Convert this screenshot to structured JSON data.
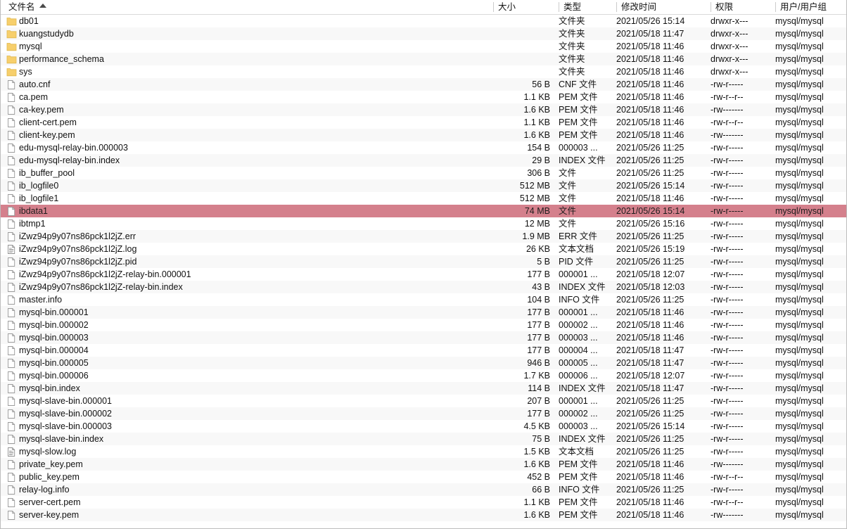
{
  "header": {
    "columns": [
      {
        "key": "name",
        "label": "文件名",
        "sorted": true,
        "sort_dir": "asc"
      },
      {
        "key": "size",
        "label": "大小",
        "sorted": false
      },
      {
        "key": "type",
        "label": "类型",
        "sorted": false
      },
      {
        "key": "mtime",
        "label": "修改时间",
        "sorted": false
      },
      {
        "key": "perm",
        "label": "权限",
        "sorted": false
      },
      {
        "key": "owner",
        "label": "用户/用户组",
        "sorted": false
      }
    ]
  },
  "colors": {
    "selection": "#d4808c",
    "row_alt": "#f8f8f8",
    "folder_icon": "#f7cf6b",
    "text": "#111111"
  },
  "rows": [
    {
      "icon": "folder-icon",
      "name": "db01",
      "size": "",
      "type": "文件夹",
      "mtime": "2021/05/26 15:14",
      "perm": "drwxr-x---",
      "owner": "mysql/mysql",
      "selected": false
    },
    {
      "icon": "folder-icon",
      "name": "kuangstudydb",
      "size": "",
      "type": "文件夹",
      "mtime": "2021/05/18 11:47",
      "perm": "drwxr-x---",
      "owner": "mysql/mysql",
      "selected": false
    },
    {
      "icon": "folder-icon",
      "name": "mysql",
      "size": "",
      "type": "文件夹",
      "mtime": "2021/05/18 11:46",
      "perm": "drwxr-x---",
      "owner": "mysql/mysql",
      "selected": false
    },
    {
      "icon": "folder-icon",
      "name": "performance_schema",
      "size": "",
      "type": "文件夹",
      "mtime": "2021/05/18 11:46",
      "perm": "drwxr-x---",
      "owner": "mysql/mysql",
      "selected": false
    },
    {
      "icon": "folder-icon",
      "name": "sys",
      "size": "",
      "type": "文件夹",
      "mtime": "2021/05/18 11:46",
      "perm": "drwxr-x---",
      "owner": "mysql/mysql",
      "selected": false
    },
    {
      "icon": "file-icon",
      "name": "auto.cnf",
      "size": "56 B",
      "type": "CNF 文件",
      "mtime": "2021/05/18 11:46",
      "perm": "-rw-r-----",
      "owner": "mysql/mysql",
      "selected": false
    },
    {
      "icon": "file-icon",
      "name": "ca.pem",
      "size": "1.1 KB",
      "type": "PEM 文件",
      "mtime": "2021/05/18 11:46",
      "perm": "-rw-r--r--",
      "owner": "mysql/mysql",
      "selected": false
    },
    {
      "icon": "file-icon",
      "name": "ca-key.pem",
      "size": "1.6 KB",
      "type": "PEM 文件",
      "mtime": "2021/05/18 11:46",
      "perm": "-rw-------",
      "owner": "mysql/mysql",
      "selected": false
    },
    {
      "icon": "file-icon",
      "name": "client-cert.pem",
      "size": "1.1 KB",
      "type": "PEM 文件",
      "mtime": "2021/05/18 11:46",
      "perm": "-rw-r--r--",
      "owner": "mysql/mysql",
      "selected": false
    },
    {
      "icon": "file-icon",
      "name": "client-key.pem",
      "size": "1.6 KB",
      "type": "PEM 文件",
      "mtime": "2021/05/18 11:46",
      "perm": "-rw-------",
      "owner": "mysql/mysql",
      "selected": false
    },
    {
      "icon": "file-icon",
      "name": "edu-mysql-relay-bin.000003",
      "size": "154 B",
      "type": "000003 ...",
      "mtime": "2021/05/26 11:25",
      "perm": "-rw-r-----",
      "owner": "mysql/mysql",
      "selected": false
    },
    {
      "icon": "file-icon",
      "name": "edu-mysql-relay-bin.index",
      "size": "29 B",
      "type": "INDEX 文件",
      "mtime": "2021/05/26 11:25",
      "perm": "-rw-r-----",
      "owner": "mysql/mysql",
      "selected": false
    },
    {
      "icon": "file-icon",
      "name": "ib_buffer_pool",
      "size": "306 B",
      "type": "文件",
      "mtime": "2021/05/26 11:25",
      "perm": "-rw-r-----",
      "owner": "mysql/mysql",
      "selected": false
    },
    {
      "icon": "file-icon",
      "name": "ib_logfile0",
      "size": "512 MB",
      "type": "文件",
      "mtime": "2021/05/26 15:14",
      "perm": "-rw-r-----",
      "owner": "mysql/mysql",
      "selected": false
    },
    {
      "icon": "file-icon",
      "name": "ib_logfile1",
      "size": "512 MB",
      "type": "文件",
      "mtime": "2021/05/18 11:46",
      "perm": "-rw-r-----",
      "owner": "mysql/mysql",
      "selected": false
    },
    {
      "icon": "file-icon",
      "name": "ibdata1",
      "size": "74 MB",
      "type": "文件",
      "mtime": "2021/05/26 15:14",
      "perm": "-rw-r-----",
      "owner": "mysql/mysql",
      "selected": true
    },
    {
      "icon": "file-icon",
      "name": "ibtmp1",
      "size": "12 MB",
      "type": "文件",
      "mtime": "2021/05/26 15:16",
      "perm": "-rw-r-----",
      "owner": "mysql/mysql",
      "selected": false
    },
    {
      "icon": "file-icon",
      "name": "iZwz94p9y07ns86pck1l2jZ.err",
      "size": "1.9 MB",
      "type": "ERR 文件",
      "mtime": "2021/05/26 11:25",
      "perm": "-rw-r-----",
      "owner": "mysql/mysql",
      "selected": false
    },
    {
      "icon": "text-file-icon",
      "name": "iZwz94p9y07ns86pck1l2jZ.log",
      "size": "26 KB",
      "type": "文本文档",
      "mtime": "2021/05/26 15:19",
      "perm": "-rw-r-----",
      "owner": "mysql/mysql",
      "selected": false
    },
    {
      "icon": "file-icon",
      "name": "iZwz94p9y07ns86pck1l2jZ.pid",
      "size": "5 B",
      "type": "PID 文件",
      "mtime": "2021/05/26 11:25",
      "perm": "-rw-r-----",
      "owner": "mysql/mysql",
      "selected": false
    },
    {
      "icon": "file-icon",
      "name": "iZwz94p9y07ns86pck1l2jZ-relay-bin.000001",
      "size": "177 B",
      "type": "000001 ...",
      "mtime": "2021/05/18 12:07",
      "perm": "-rw-r-----",
      "owner": "mysql/mysql",
      "selected": false
    },
    {
      "icon": "file-icon",
      "name": "iZwz94p9y07ns86pck1l2jZ-relay-bin.index",
      "size": "43 B",
      "type": "INDEX 文件",
      "mtime": "2021/05/18 12:03",
      "perm": "-rw-r-----",
      "owner": "mysql/mysql",
      "selected": false
    },
    {
      "icon": "file-icon",
      "name": "master.info",
      "size": "104 B",
      "type": "INFO 文件",
      "mtime": "2021/05/26 11:25",
      "perm": "-rw-r-----",
      "owner": "mysql/mysql",
      "selected": false
    },
    {
      "icon": "file-icon",
      "name": "mysql-bin.000001",
      "size": "177 B",
      "type": "000001 ...",
      "mtime": "2021/05/18 11:46",
      "perm": "-rw-r-----",
      "owner": "mysql/mysql",
      "selected": false
    },
    {
      "icon": "file-icon",
      "name": "mysql-bin.000002",
      "size": "177 B",
      "type": "000002 ...",
      "mtime": "2021/05/18 11:46",
      "perm": "-rw-r-----",
      "owner": "mysql/mysql",
      "selected": false
    },
    {
      "icon": "file-icon",
      "name": "mysql-bin.000003",
      "size": "177 B",
      "type": "000003 ...",
      "mtime": "2021/05/18 11:46",
      "perm": "-rw-r-----",
      "owner": "mysql/mysql",
      "selected": false
    },
    {
      "icon": "file-icon",
      "name": "mysql-bin.000004",
      "size": "177 B",
      "type": "000004 ...",
      "mtime": "2021/05/18 11:47",
      "perm": "-rw-r-----",
      "owner": "mysql/mysql",
      "selected": false
    },
    {
      "icon": "file-icon",
      "name": "mysql-bin.000005",
      "size": "946 B",
      "type": "000005 ...",
      "mtime": "2021/05/18 11:47",
      "perm": "-rw-r-----",
      "owner": "mysql/mysql",
      "selected": false
    },
    {
      "icon": "file-icon",
      "name": "mysql-bin.000006",
      "size": "1.7 KB",
      "type": "000006 ...",
      "mtime": "2021/05/18 12:07",
      "perm": "-rw-r-----",
      "owner": "mysql/mysql",
      "selected": false
    },
    {
      "icon": "file-icon",
      "name": "mysql-bin.index",
      "size": "114 B",
      "type": "INDEX 文件",
      "mtime": "2021/05/18 11:47",
      "perm": "-rw-r-----",
      "owner": "mysql/mysql",
      "selected": false
    },
    {
      "icon": "file-icon",
      "name": "mysql-slave-bin.000001",
      "size": "207 B",
      "type": "000001 ...",
      "mtime": "2021/05/26 11:25",
      "perm": "-rw-r-----",
      "owner": "mysql/mysql",
      "selected": false
    },
    {
      "icon": "file-icon",
      "name": "mysql-slave-bin.000002",
      "size": "177 B",
      "type": "000002 ...",
      "mtime": "2021/05/26 11:25",
      "perm": "-rw-r-----",
      "owner": "mysql/mysql",
      "selected": false
    },
    {
      "icon": "file-icon",
      "name": "mysql-slave-bin.000003",
      "size": "4.5 KB",
      "type": "000003 ...",
      "mtime": "2021/05/26 15:14",
      "perm": "-rw-r-----",
      "owner": "mysql/mysql",
      "selected": false
    },
    {
      "icon": "file-icon",
      "name": "mysql-slave-bin.index",
      "size": "75 B",
      "type": "INDEX 文件",
      "mtime": "2021/05/26 11:25",
      "perm": "-rw-r-----",
      "owner": "mysql/mysql",
      "selected": false
    },
    {
      "icon": "text-file-icon",
      "name": "mysql-slow.log",
      "size": "1.5 KB",
      "type": "文本文档",
      "mtime": "2021/05/26 11:25",
      "perm": "-rw-r-----",
      "owner": "mysql/mysql",
      "selected": false
    },
    {
      "icon": "file-icon",
      "name": "private_key.pem",
      "size": "1.6 KB",
      "type": "PEM 文件",
      "mtime": "2021/05/18 11:46",
      "perm": "-rw-------",
      "owner": "mysql/mysql",
      "selected": false
    },
    {
      "icon": "file-icon",
      "name": "public_key.pem",
      "size": "452 B",
      "type": "PEM 文件",
      "mtime": "2021/05/18 11:46",
      "perm": "-rw-r--r--",
      "owner": "mysql/mysql",
      "selected": false
    },
    {
      "icon": "file-icon",
      "name": "relay-log.info",
      "size": "66 B",
      "type": "INFO 文件",
      "mtime": "2021/05/26 11:25",
      "perm": "-rw-r-----",
      "owner": "mysql/mysql",
      "selected": false
    },
    {
      "icon": "file-icon",
      "name": "server-cert.pem",
      "size": "1.1 KB",
      "type": "PEM 文件",
      "mtime": "2021/05/18 11:46",
      "perm": "-rw-r--r--",
      "owner": "mysql/mysql",
      "selected": false
    },
    {
      "icon": "file-icon",
      "name": "server-key.pem",
      "size": "1.6 KB",
      "type": "PEM 文件",
      "mtime": "2021/05/18 11:46",
      "perm": "-rw-------",
      "owner": "mysql/mysql",
      "selected": false
    }
  ]
}
